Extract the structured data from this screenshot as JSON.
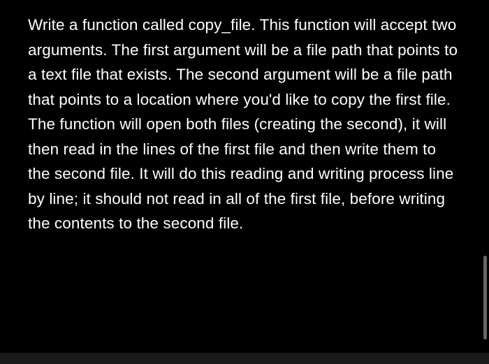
{
  "content": {
    "paragraph": "Write a function called copy_file. This function will accept two arguments. The first argument will be a file path that points to a text file that exists. The second argument will be a file path that points to a location where you'd like to copy the first file. The function will open both files (creating the second), it will then read in the lines of the first file and then write them to the second file.  It will do this reading and writing process line by line; it should not read in all of the first file, before writing the contents to the second file."
  }
}
